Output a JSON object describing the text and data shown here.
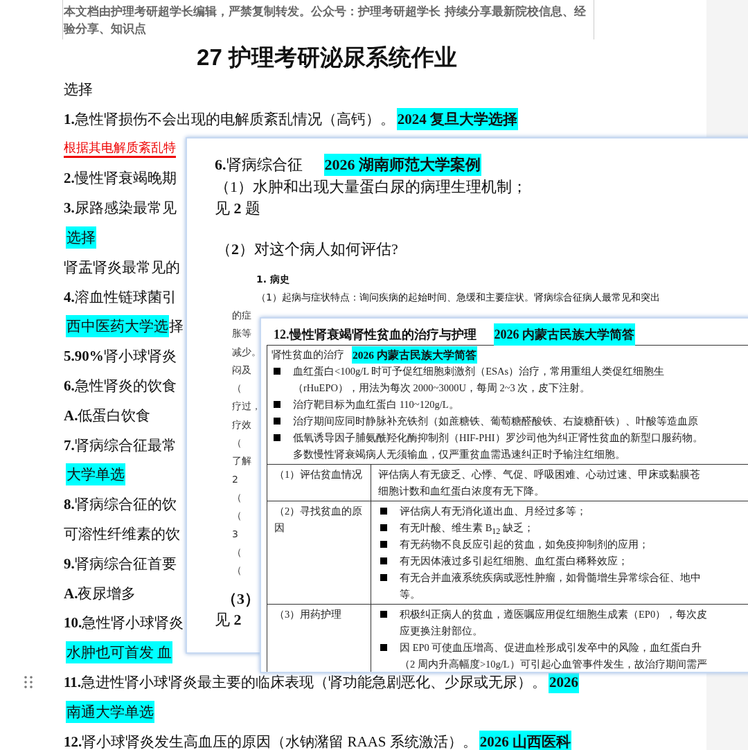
{
  "header_note": "本文档由护理考研超学长编辑，严禁复制转发。公众号：护理考研超学长 持续分享最新院校信息、经验分享、知识点",
  "title": "27 护理考研泌尿系统作业",
  "lines": [
    {
      "kind": "plain",
      "text": "选择"
    },
    {
      "kind": "plain",
      "text": "**1.**急性肾损伤不会出现的电解质紊乱情况（高钙）。",
      "highlight": "2024 复旦大学选择",
      "highlight_bold": true
    },
    {
      "kind": "note",
      "text": "根据其电解质紊乱特"
    },
    {
      "kind": "plain",
      "text": "**2.**慢性肾衰竭晚期"
    },
    {
      "kind": "plain",
      "text": "**3.**尿路感染最常见"
    },
    {
      "kind": "plain",
      "highlight": "选择",
      "highlight_bold": false
    },
    {
      "kind": "plain",
      "text": "肾盂肾炎最常见的"
    },
    {
      "kind": "plain",
      "text": "**4.**溶血性链球菌引"
    },
    {
      "kind": "plain",
      "highlight": "西中医药大学选",
      "highlight_bold": false,
      "after": "择"
    },
    {
      "kind": "plain",
      "text": "**5.90%**肾小球肾炎"
    },
    {
      "kind": "plain",
      "text": "**6.**急性肾炎的饮食"
    },
    {
      "kind": "plain",
      "text": "**A.**低蛋白饮食"
    },
    {
      "kind": "plain",
      "text": "**7.**肾病综合征最常"
    },
    {
      "kind": "plain",
      "highlight": "大学单选",
      "highlight_bold": false
    },
    {
      "kind": "plain",
      "text": "**8.**肾病综合征的饮"
    },
    {
      "kind": "plain",
      "text": "可溶性纤维素的饮"
    },
    {
      "kind": "plain",
      "text": "**9.**肾病综合征首要"
    },
    {
      "kind": "plain",
      "text": "**A.**夜尿增多"
    },
    {
      "kind": "plain",
      "text": "**10.**急性肾小球肾炎"
    },
    {
      "kind": "plain",
      "highlight": "水肿也可首发  血",
      "highlight_bold": false
    },
    {
      "kind": "plain",
      "text": "**11.**急进性肾小球肾炎最主要的临床表现（肾功能急剧恶化、少尿或无尿）。",
      "highlight": "2026",
      "highlight_bold": true
    },
    {
      "kind": "plain",
      "highlight": "南通大学单选",
      "highlight_bold": false
    },
    {
      "kind": "plain",
      "text": "**12.**肾小球肾炎发生高血压的原因（水钠潴留 RAAS 系统激活）。",
      "highlight": "2026 山西医科",
      "highlight_bold": true
    }
  ],
  "clip_1": {
    "heading": "**6.**肾病综合征",
    "heading_highlight": "2026 湖南师范大学案例",
    "lines": [
      "（1）水肿和出现大量蛋白尿的病理生理机制；",
      "见 **2** 题"
    ],
    "question": "（**2**）对这个病人如何评估?",
    "section": "1. 病史",
    "paragraph": "（1）起病与症状特点：询问疾病的起始时间、急缓和主要症状。肾病综合征病人最常见和突出",
    "fragments": [
      "的症",
      "胀等",
      "减少。",
      "闷及",
      "（",
      "疗过，",
      "疗效",
      "（",
      "了解",
      "2",
      "（",
      "（",
      "3",
      "（",
      "（"
    ],
    "footer": [
      "（**3**）",
      "见 **2**"
    ]
  },
  "clip_2": {
    "heading": "**12.**慢性肾衰竭肾性贫血的治疗与护理",
    "heading_highlight": "2026 内蒙古民族大学简答",
    "table": {
      "intro": "肾性贫血的治疗",
      "intro_highlight": "2026 内蒙古民族大学简答",
      "intro_bullets": [
        [
          "血红蛋白<100g/L 时可予促红细胞刺激剂（ESAs）治疗，常用重组人类促红细胞生",
          "（rHuEPO），用法为每次 2000~3000U，每周 2~3 次，皮下注射。"
        ],
        [
          "治疗靶目标为血红蛋白 110~120g/L。"
        ],
        [
          "治疗期间应同时静脉补充铁剂（如蔗糖铁、葡萄糖醛酸铁、右旋糖酐铁）、叶酸等造血原"
        ],
        [
          "低氧诱导因子脯氨酰羟化酶抑制剂（HIF-PHI）罗沙司他为纠正肾性贫血的新型口服药物。",
          "多数慢性肾衰竭病人无须输血，仅严重贫血需迅速纠正时予输注红细胞。"
        ]
      ],
      "rows": [
        {
          "kind": "text",
          "label": "（1）评估贫血情况",
          "lines": [
            "评估病人有无疲乏、心悸、气促、呼吸困难、心动过速、甲床或黏膜苍",
            "细胞计数和血红蛋白浓度有无下降。"
          ]
        },
        {
          "kind": "bullets",
          "label": "（2）寻找贫血的原因",
          "bullets": [
            [
              "评估病人有无消化道出血、月经过多等；"
            ],
            [
              "有无叶酸、维生素 B$_{12}$ 缺乏；"
            ],
            [
              "有无药物不良反应引起的贫血，如免疫抑制剂的应用；"
            ],
            [
              "有无因体液过多引起红细胞、血红蛋白稀释效应；"
            ],
            [
              "有无合并血液系统疾病或恶性肿瘤，如骨髓增生异常综合征、地中",
              "等。"
            ]
          ]
        },
        {
          "kind": "bullets",
          "label": "（3）用药护理",
          "bullets": [
            [
              "积极纠正病人的贫血，遵医嘱应用促红细胞生成素（EP0），每次皮",
              "应更换注射部位。"
            ],
            [
              "因 EP0 可使血压增高、促进血栓形成引发卒中的风险，血红蛋白升",
              "（2 周内升高幅度>10g/L）可引起心血管事件发生，故治疗期间需严"
            ]
          ]
        }
      ]
    }
  }
}
